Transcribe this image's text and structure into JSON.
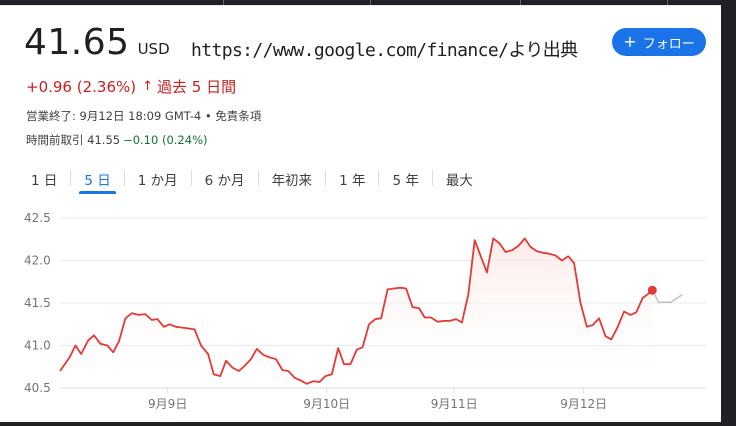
{
  "quote": {
    "price": "41.65",
    "currency": "USD",
    "change_text": "+0.96 (2.36%)",
    "change_arrow": "↑",
    "period_text": "過去 5 日間",
    "status": "営業終了: 9月12日 18:09 GMT-4 • 免責条項",
    "premarket_label": "時間前取引 41.55",
    "premarket_change": "−0.10 (0.24%)"
  },
  "source_note": "https://www.google.com/finance/より出典",
  "follow_button": {
    "plus": "+",
    "label": "フォロー"
  },
  "tabs": [
    {
      "label": "1 日",
      "active": false
    },
    {
      "label": "5 日",
      "active": true
    },
    {
      "label": "1 か月",
      "active": false
    },
    {
      "label": "6 か月",
      "active": false
    },
    {
      "label": "年初来",
      "active": false
    },
    {
      "label": "1 年",
      "active": false
    },
    {
      "label": "5 年",
      "active": false
    },
    {
      "label": "最大",
      "active": false
    }
  ],
  "colors": {
    "line": "#e53935",
    "fill": "#fce8e6",
    "extension": "#bdc1c6",
    "grid": "#e8eaed",
    "axis_text": "#70757a",
    "accent": "#1a73e8"
  },
  "chart_data": {
    "type": "area",
    "title": "",
    "xlabel": "",
    "ylabel": "",
    "ylim": [
      40.5,
      42.5
    ],
    "yticks": [
      "40.5",
      "41.0",
      "41.5",
      "42.0",
      "42.5"
    ],
    "xlim": [
      0,
      100
    ],
    "categories": [
      "9月9日",
      "9月10日",
      "9月11日",
      "9月12日"
    ],
    "category_positions": [
      16.8,
      41.6,
      61.5,
      81.7
    ],
    "grid": true,
    "series": [
      {
        "x": [
          0,
          1.5,
          2.4,
          3.3,
          4.4,
          5.3,
          6.3,
          7.4,
          8.3,
          9.2,
          10.2,
          11.2,
          12.3,
          13.3,
          14.3,
          15.2,
          16.2,
          17.1,
          18.1,
          19.1,
          20.1,
          21.0,
          22.0,
          23.1,
          24.0,
          25.0,
          25.9,
          26.9,
          27.9,
          28.8,
          29.8,
          30.7,
          31.7,
          32.7,
          33.7,
          34.7,
          35.6,
          36.6,
          37.5,
          38.5,
          39.5,
          40.5,
          41.4,
          42.4,
          43.4,
          44.3,
          45.3,
          46.3,
          47.2,
          48.2,
          49.2,
          50.1,
          51.1,
          52.1,
          53.1,
          54.0,
          55.0,
          56.0,
          56.9,
          57.9,
          58.9,
          59.9,
          60.8,
          61.8,
          62.7,
          63.7,
          64.7,
          65.7,
          66.6,
          67.6,
          68.6,
          69.5,
          70.5,
          71.5,
          72.5,
          73.4,
          74.4,
          75.4,
          76.3,
          77.3,
          78.3,
          79.3,
          80.2,
          81.2,
          82.2,
          83.1,
          84.1,
          85.1,
          86.0,
          87.0,
          88.0,
          89.0,
          89.9,
          90.9,
          91.8,
          92.4
        ],
        "y": [
          40.7,
          40.86,
          41.0,
          40.9,
          41.06,
          41.12,
          41.02,
          41.0,
          40.92,
          41.05,
          41.32,
          41.38,
          41.36,
          41.37,
          41.3,
          41.31,
          41.22,
          41.25,
          41.22,
          41.21,
          41.2,
          41.19,
          41.0,
          40.9,
          40.66,
          40.64,
          40.82,
          40.74,
          40.7,
          40.76,
          40.84,
          40.96,
          40.89,
          40.86,
          40.84,
          40.71,
          40.7,
          40.62,
          40.59,
          40.55,
          40.58,
          40.57,
          40.64,
          40.66,
          40.97,
          40.78,
          40.78,
          40.95,
          40.98,
          41.25,
          41.31,
          41.32,
          41.66,
          41.67,
          41.68,
          41.67,
          41.45,
          41.44,
          41.33,
          41.33,
          41.28,
          41.29,
          41.29,
          41.31,
          41.27,
          41.6,
          42.24,
          42.04,
          41.86,
          42.26,
          42.2,
          42.1,
          42.12,
          42.17,
          42.26,
          42.16,
          42.11,
          42.09,
          42.08,
          42.06,
          42.0,
          42.05,
          41.97,
          41.5,
          41.22,
          41.24,
          41.32,
          41.11,
          41.07,
          41.22,
          41.4,
          41.36,
          41.39,
          41.56,
          41.61,
          41.65
        ]
      }
    ],
    "extension": {
      "x": [
        92.4,
        93.4,
        95.3,
        97.1
      ],
      "y": [
        41.65,
        41.51,
        41.51,
        41.6
      ]
    }
  }
}
